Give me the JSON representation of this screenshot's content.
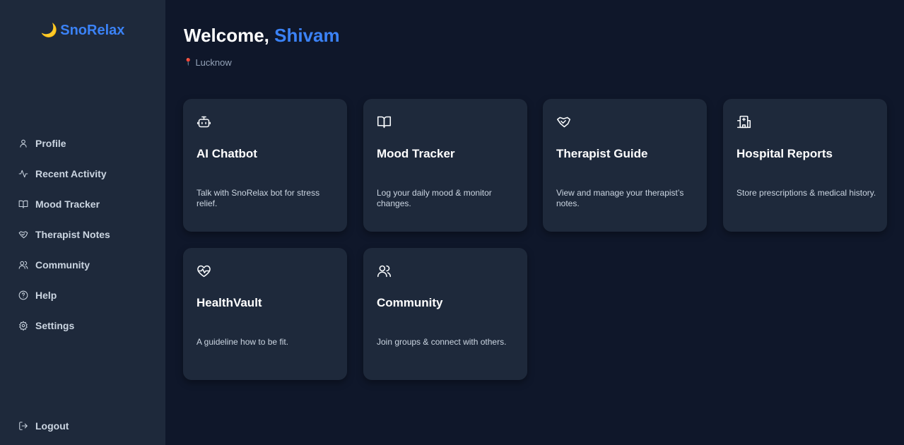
{
  "brand": {
    "icon": "moon-icon",
    "name": "SnoRelax"
  },
  "sidebar": {
    "items": [
      {
        "label": "Profile",
        "icon": "user-icon"
      },
      {
        "label": "Recent Activity",
        "icon": "activity-icon"
      },
      {
        "label": "Mood Tracker",
        "icon": "book-open-icon"
      },
      {
        "label": "Therapist Notes",
        "icon": "handshake-icon"
      },
      {
        "label": "Community",
        "icon": "users-icon"
      },
      {
        "label": "Help",
        "icon": "help-circle-icon"
      },
      {
        "label": "Settings",
        "icon": "gear-icon"
      }
    ],
    "logout": {
      "label": "Logout",
      "icon": "logout-icon"
    }
  },
  "header": {
    "welcome_prefix": "Welcome, ",
    "user_name": "Shivam",
    "location": "Lucknow"
  },
  "cards": [
    {
      "title": "AI Chatbot",
      "description": "Talk with SnoRelax bot for stress relief.",
      "icon": "bot-icon"
    },
    {
      "title": "Mood Tracker",
      "description": "Log your daily mood & monitor changes.",
      "icon": "book-open-icon"
    },
    {
      "title": "Therapist Guide",
      "description": "View and manage your therapist’s notes.",
      "icon": "handshake-icon"
    },
    {
      "title": "Hospital Reports",
      "description": "Store prescriptions & medical history.",
      "icon": "hospital-icon"
    },
    {
      "title": "HealthVault",
      "description": "A guideline how to be fit.",
      "icon": "heart-pulse-icon"
    },
    {
      "title": "Community",
      "description": "Join groups & connect with others.",
      "icon": "users-icon"
    }
  ],
  "colors": {
    "background": "#0f172a",
    "sidebar": "#1e293b",
    "card": "#1e293b",
    "accent": "#3b82f6",
    "moon": "#facc15",
    "pin": "#ef4444"
  }
}
